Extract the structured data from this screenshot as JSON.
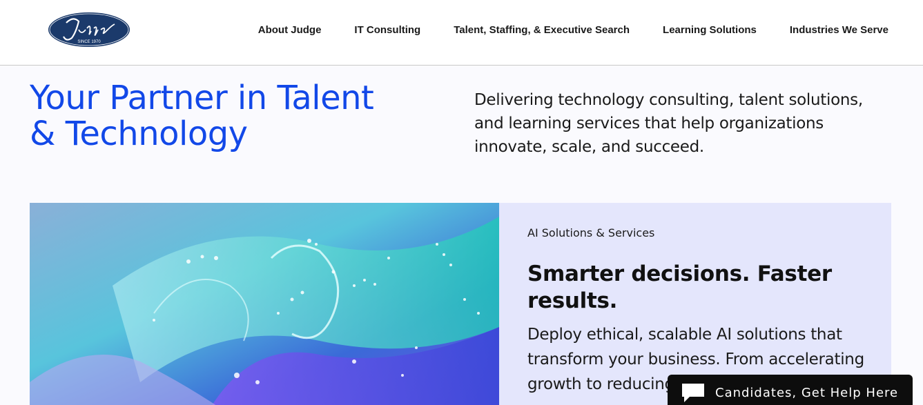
{
  "brand": {
    "logo_text": "Judge",
    "logo_tagline": "SINCE 1970",
    "logo_color": "#1b3a6b"
  },
  "nav": {
    "items": [
      {
        "label": "About Judge"
      },
      {
        "label": "IT Consulting"
      },
      {
        "label": "Talent, Staffing, & Executive Search"
      },
      {
        "label": "Learning Solutions"
      },
      {
        "label": "Industries We Serve"
      }
    ]
  },
  "hero": {
    "title_line1": "Your Partner in Talent",
    "title_line2": "& Technology",
    "subtitle": "Delivering technology consulting, talent solutions, and learning services that help organizations innovate, scale, and succeed.",
    "accent_color": "#1248e8"
  },
  "feature_card": {
    "eyebrow": "AI Solutions & Services",
    "heading": "Smarter decisions. Faster results.",
    "body": "Deploy ethical, scalable AI solutions that transform your business. From accelerating growth to reducing",
    "panel_color": "#e4e6fc"
  },
  "help_widget": {
    "label": "Candidates, Get Help Here",
    "icon": "chat-bubble-icon"
  }
}
